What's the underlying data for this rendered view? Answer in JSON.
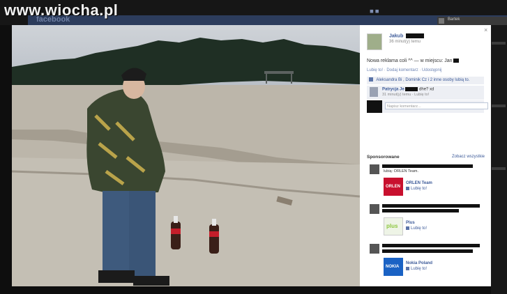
{
  "watermark": "www.wiocha.pl",
  "background": {
    "site_logo": "facebook",
    "right_header_text": "Bartek",
    "bar_color": "#2c3c5c"
  },
  "photo": {
    "description_icon": "photo-of-person-on-beach-with-two-bottles"
  },
  "panel": {
    "close": "×",
    "author_name": "Jakub",
    "timestamp": "36 minut(y) temu",
    "post_text": "Nowa reklama coli ^^ — w miejscu: Jan",
    "actions": "Lubię to! · Dodaj komentarz · Udostępnij",
    "likes_text": "Aleksandra Bi , Dominik Cz i 2 inne osoby lubią to.",
    "comment": {
      "author": "Patrycja Je",
      "text": "dhe? xd",
      "meta": "31 minut(y) temu · Lubię to!"
    },
    "write_placeholder": "Napisz komentarz...",
    "sponsored_label": "Sponsorowane",
    "see_all": "Zobacz wszystkie",
    "ads": [
      {
        "small": "lubią: ORLEN Team.",
        "logo_text": "ORLEN",
        "title": "ORLEN Team",
        "like": "Lubię to!",
        "color": "#c8102e"
      },
      {
        "small": "",
        "logo_text": "plus",
        "title": "Plus",
        "like": "Lubię to!",
        "color": "#8cc63f"
      },
      {
        "small": "",
        "logo_text": "NOKIA",
        "title": "Nokia Poland",
        "like": "Lubię to!",
        "color": "#1a62c4"
      }
    ]
  }
}
